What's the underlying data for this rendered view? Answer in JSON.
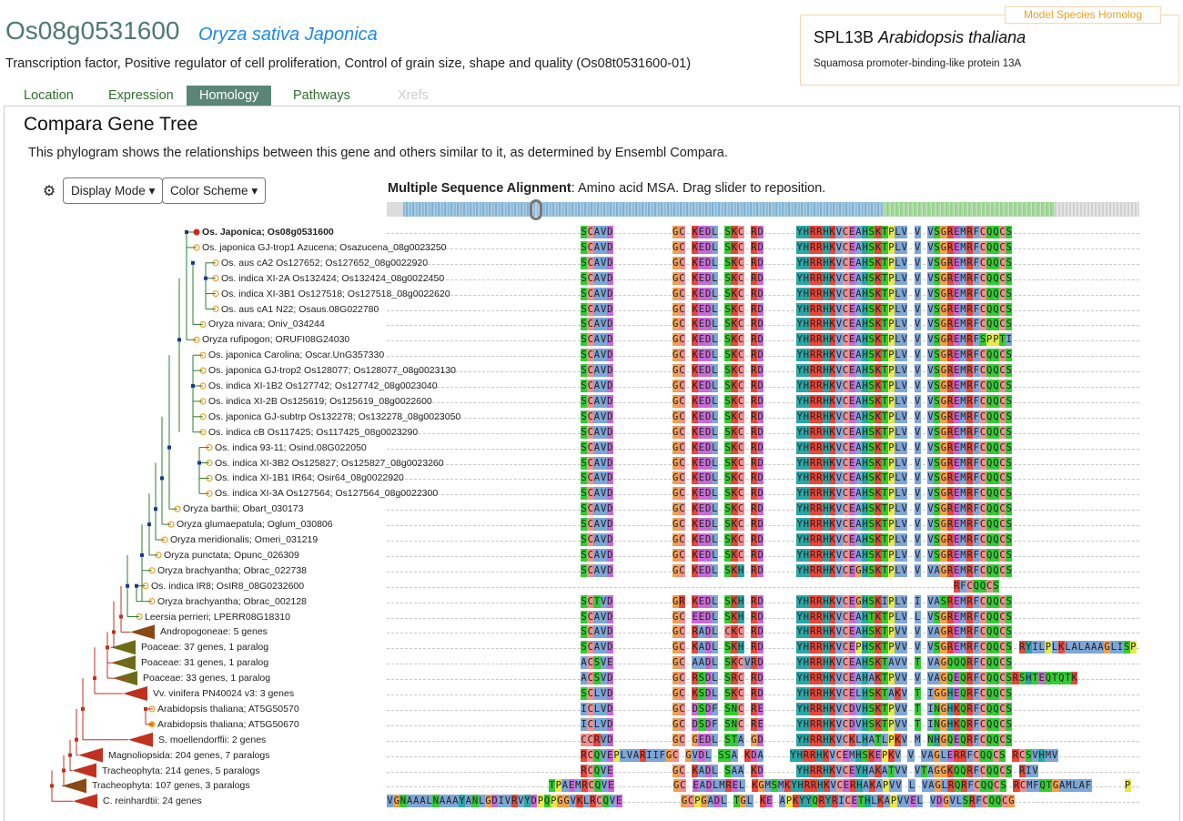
{
  "header": {
    "gene_id": "Os08g0531600",
    "species": "Oryza sativa Japonica",
    "description": "Transcription factor, Positive regulator of cell proliferation, Control of grain size, shape and quality (Os08t0531600-01)"
  },
  "homolog": {
    "tag": "Model Species Homolog",
    "name": "SPL13B",
    "species": "Arabidopsis thaliana",
    "description": "Squamosa promoter-binding-like protein 13A"
  },
  "tabs": [
    {
      "label": "Location",
      "state": "normal"
    },
    {
      "label": "Expression",
      "state": "normal"
    },
    {
      "label": "Homology",
      "state": "active"
    },
    {
      "label": "Pathways",
      "state": "normal"
    },
    {
      "label": "Xrefs",
      "state": "disabled"
    }
  ],
  "panel": {
    "title": "Compara Gene Tree",
    "description": "This phylogram shows the relationships between this gene and others similar to it, as determined by Ensembl Compara."
  },
  "controls": {
    "gear_icon": "gear-icon",
    "display_mode": "Display Mode",
    "color_scheme": "Color Scheme"
  },
  "msa": {
    "title": "Multiple Sequence Alignment",
    "subtitle": ": Amino acid MSA. Drag slider to reposition."
  },
  "colors": {
    "tab_active": "#5a8577",
    "gene_id": "#4e7a6f",
    "species_link": "#1e88e5",
    "homolog_tag": "#f0a020",
    "aa_hydrophobic": "#7ea6d8",
    "aa_polar": "#33cc33",
    "aa_positive": "#e6483b",
    "aa_negative": "#c86ad6",
    "aa_glycine": "#f0a050",
    "aa_proline": "#e8e84a",
    "aa_cysteine": "#f09090",
    "aa_aromatic": "#2aa6a6"
  },
  "rows": [
    {
      "label": "Os. Japonica; Os08g0531600",
      "bold": true,
      "node": "red-dot",
      "seq": "SCAVD---------GC-KEDL-SKC-RD-----YHRRHKVCEAHSKTPLV-V-VSGREMRFCQQCS"
    },
    {
      "label": "Os. japonica GJ-trop1 Azucena; Osazucena_08g0023250",
      "node": "orange-circle",
      "seq": "SCAVD---------GC-KEDL-SKC-RD-----YHRRHKVCEAHSKTPLV-V-VSGREMRFCQQCS"
    },
    {
      "label": "Os. aus cA2 Os127652; Os127652_08g0022920",
      "node": "orange-circle",
      "seq": "SCAVD---------GC-KEDL-SKC-RD-----YHRRHKVCEAHSKTPLV-V-VSGREMRFCQQCS"
    },
    {
      "label": "Os. indica XI-2A Os132424; Os132424_08g0022450",
      "node": "orange-circle",
      "seq": "SCAVD---------GC-KEDL-SKC-RD-----YHRRHKVCEAHSKTPLV-V-VSGREMRFCQQCS"
    },
    {
      "label": "Os. indica XI-3B1 Os127518; Os127518_08g0022620",
      "node": "orange-circle",
      "seq": "SCAVD---------GC-KEDL-SKC-RD-----YHRRHKVCEAHSKTPLV-V-VSGREMRFCQQCS"
    },
    {
      "label": "Os. aus cA1 N22; Osaus.08G022780",
      "node": "orange-circle",
      "seq": "SCAVD---------GC-KEDL-SKC-RD-----YHRRHKVCEAHSKTPLV-V-VSGREMRFCQQCS"
    },
    {
      "label": "Oryza nivara; Oniv_034244",
      "node": "orange-circle",
      "seq": "SCAVD---------GC-KEDL-SKC-RD-----YHRRHKVCEAHSKTPLV-V-VSGREMRFCQQCS"
    },
    {
      "label": "Oryza rufipogon; ORUFI08G24030",
      "node": "orange-circle",
      "seq": "SCAVD---------GC-KEDL-SKC-RD-----YHRRHKVCEAHSKTPLV-V-VSGREMRFSPPTI"
    },
    {
      "label": "Os. japonica Carolina; Oscar.UnG357330",
      "node": "orange-circle",
      "seq": "SCAVD---------GC-KEDL-SKC-RD-----YHRRHKVCEAHSKTPLV-V-VSGREMRFCQQCS"
    },
    {
      "label": "Os. japonica GJ-trop2 Os128077; Os128077_08g0023130",
      "node": "orange-circle",
      "seq": "SCAVD---------GC-KEDL-SKC-RD-----YHRRHKVCEAHSKTPLV-V-VSGREMRFCQQCS"
    },
    {
      "label": "Os. indica XI-1B2 Os127742; Os127742_08g0023040",
      "node": "orange-circle",
      "seq": "SCAVD---------GC-KEDL-SKC-RD-----YHRRHKVCEAHSKTPLV-V-VSGREMRFCQQCS"
    },
    {
      "label": "Os. indica XI-2B Os125619; Os125619_08g0022600",
      "node": "orange-circle",
      "seq": "SCAVD---------GC-KEDL-SKC-RD-----YHRRHKVCEAHSKTPLV-V-VSGREMRFCQQCS"
    },
    {
      "label": "Os. japonica GJ-subtrp Os132278; Os132278_08g0023050",
      "node": "orange-circle",
      "seq": "SCAVD---------GC-KEDL-SKC-RD-----YHRRHKVCEAHSKTPLV-V-VSGREMRFCQQCS"
    },
    {
      "label": "Os. indica cB Os117425; Os117425_08g0023290",
      "node": "orange-circle",
      "seq": "SCAVD---------GC-KEDL-SKC-RD-----YHRRHKVCEAHSKTPLV-V-VSGREMRFCQQCS"
    },
    {
      "label": "Os. indica 93-11; Osind.08G022050",
      "node": "orange-circle",
      "seq": "SCAVD---------GC-KEDL-SKC-RD-----YHRRHKVCEAHSKTPLV-V-VSGREMRFCQQCS"
    },
    {
      "label": "Os. indica XI-3B2 Os125827; Os125827_08g0023260",
      "node": "orange-circle",
      "seq": "SCAVD---------GC-KEDL-SKC-RD-----YHRRHKVCEAHSKTPLV-V-VSGREMRFCQQCS"
    },
    {
      "label": "Os. indica XI-1B1 IR64; Osir64_08g0022920",
      "node": "orange-circle",
      "seq": "SCAVD---------GC-KEDL-SKC-RD-----YHRRHKVCEAHSKTPLV-V-VSGREMRFCQQCS"
    },
    {
      "label": "Os. indica XI-3A Os127564; Os127564_08g0022300",
      "node": "orange-circle",
      "seq": "SCAVD---------GC-KEDL-SKC-RD-----YHRRHKVCEAHSKTPLV-V-VSGREMRFCQQCS"
    },
    {
      "label": "Oryza barthii; Obart_030173",
      "node": "orange-circle",
      "seq": "SCAVD---------GC-KEDL-SKC-RD-----YHRRHKVCEAHSKTPLV-V-VSGREMRFCQQCS"
    },
    {
      "label": "Oryza glumaepatula; Oglum_030806",
      "node": "orange-circle",
      "seq": "SCAVD---------GC-KEDL-SKC-RD-----YHRRHKVCEAHSKTPLV-V-VSGREMRFCQQCS"
    },
    {
      "label": "Oryza meridionalis; Omeri_031219",
      "node": "orange-circle",
      "seq": "SCAVD---------GC-KEDL-SKC-RD-----YHRRHKVCEAHSKTPLV-V-VSGREMRFCQQCS"
    },
    {
      "label": "Oryza punctata; Opunc_026309",
      "node": "orange-circle",
      "seq": "SCAVD---------GC-KEDL-SKC-RD-----YHRRHKVCEAHSKTPLV-V-VSGREMRFCQQCS"
    },
    {
      "label": "Oryza brachyantha; Obrac_022738",
      "node": "orange-circle",
      "seq": "SCAVD---------GC-KEDL-SKH-RD-----YHRRHKVCEGHSKTPLV-V-VAGREMRFCQQCS"
    },
    {
      "label": "Os. indica IR8; OsIR8_08G0232600",
      "node": "orange-circle",
      "seq": "---------------------------------------------------------RFCQQCS"
    },
    {
      "label": "Oryza brachyantha; Obrac_002128",
      "node": "orange-circle",
      "seq": "SCTVD---------GR-KEDL-SKH-RD-----YHRRHKVCEGHSKIPLV-I-VASREMRFCQQCS"
    },
    {
      "label": "Leersia perrieri; LPERR08G18310",
      "node": "orange-circle",
      "seq": "SCAVD---------GC-EEDL-SKH-RD-----YHRRHKVCEAHTKTPLV-L-VSGREMRFCQQCS"
    },
    {
      "label": "Andropogoneae: 5 genes",
      "node": "brown-triangle",
      "seq": "SCAVD---------GC-RADL-CKC-RD-----YHRRHKVCEAHSKTPVV-V-VAGREMRFCQQCS"
    },
    {
      "label": "Poaceae: 37 genes, 1 paralog",
      "node": "olive-triangle",
      "seq": "SCAVD---------GC-KADL-SKH-RD-----YHRRHKVCEPHSKTPVV-V-VSGREMRFCQQCS-RYILPLKLALAAAGLISPSSWQFLMY"
    },
    {
      "label": "Poaceae: 31 genes, 1 paralog",
      "node": "olive-triangle",
      "seq": "ACSVE---------GC-AADL-SKCVRD-----YHRRHKVCEAHSKTAVV-T-VAGQQQRFCQQCS"
    },
    {
      "label": "Poaceae: 33 genes, 1 paralog",
      "node": "olive-triangle",
      "seq": "ACSVD---------GC-RSDL-SRC-RD-----YHRRHKVCEAHAKTPVV-V-VAGQEQRFCQQCSRSHTEQTQTK"
    },
    {
      "label": "Vv. vinifera PN40024 v3: 3 genes",
      "node": "red-triangle",
      "seq": "SCLVD---------GC-KSDL-SKC-RD-----YHRRHKVCELHSKTAKV-T-IGGHEQRFCQQCS"
    },
    {
      "label": "Arabidopsis thaliana; AT5G50570",
      "node": "orange-circle",
      "seq": "ICLVD---------GC-DSDF-SNC-RE-----YHRRHKVCDVHSKTPVV-T-INGHKQRFCQQCS"
    },
    {
      "label": "Arabidopsis thaliana; AT5G50670",
      "node": "orange-dot",
      "seq": "ICLVD---------GC-DSDF-SNC-RE-----YHRRHKVCDVHSKTPVV-T-INGHKQRFCQQCS"
    },
    {
      "label": "S. moellendorffii: 2 genes",
      "node": "red-triangle",
      "seq": "CCRVD---------GC-GEDL-STA-GD-----YHRRHKVCKLHATLPKV-M-NHGQEQRFCQQCS"
    },
    {
      "label": "Magnoliopsida: 204 genes, 7 paralogs",
      "node": "red-triangle",
      "seq": "RCQVEPLVARIIFGC-GVDL-SSA-KDA----YHRRHKVCEMHSKEPKV-V-VAGLERRFCQQCS-RCSVHMV"
    },
    {
      "label": "Tracheophyta: 214 genes, 5 paralogs",
      "node": "red-triangle",
      "seq": "RCQVE---------GC-KADL-SAA-KD-----YHRRHKVCEYHAKATVV-VTAGGKQQRFCQQCS-RIV"
    },
    {
      "label": "Tracheophyta: 107 genes, 3 paralogs",
      "node": "brown-triangle",
      "seq": "TPAEMRCQVE---------GC-EADLMREL-KGMSMKYHRRHKVCERHAKAPVV-L-VAGLRQRFCQQCS-RCMFQTGAMLAF-----P"
    },
    {
      "label": "C. reinhardtii: 24 genes",
      "node": "red-triangle",
      "seq": "VGNAAALNAAAYANLGDIVRVYDPQPGGVKLRCQVE---------GCPGADL-TGL-KE-APKYYQRYRICETHLKAPVVEL-VDGVLSRFCQQCG"
    }
  ]
}
